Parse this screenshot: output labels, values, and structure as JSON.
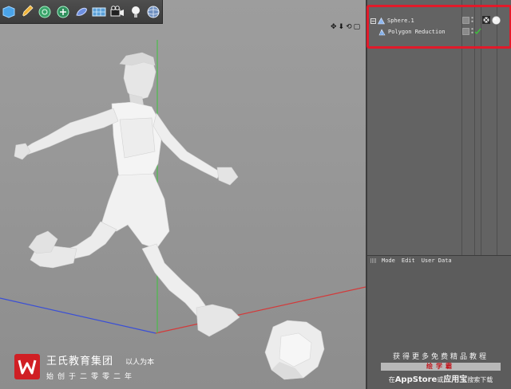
{
  "toolbar": {
    "icons": [
      "cube-add-icon",
      "pen-icon",
      "subdivision-icon",
      "array-icon",
      "deformer-icon",
      "floor-icon",
      "camera-icon",
      "light-icon",
      "sphere-material-icon"
    ]
  },
  "viewport": {
    "nav_icons": [
      "✥",
      "⬇",
      "⟲",
      "▢"
    ]
  },
  "object_manager": {
    "objects": [
      {
        "name": "Sphere.1",
        "icon": "polygon-object-icon"
      },
      {
        "name": "Polygon Reduction",
        "icon": "polygon-reduction-icon"
      }
    ],
    "highlight_color": "#e11a2a"
  },
  "attribute_manager": {
    "menu": [
      "Mode",
      "Edit",
      "User Data"
    ]
  },
  "watermark_left": {
    "brand": "王氏教育集团",
    "slogan": "以人为本",
    "founded": "始创于二零零二年"
  },
  "watermark_right": {
    "line1": "获得更多免费精品教程",
    "app": "绘学霸",
    "line3_pre": "在",
    "line3_store": "AppStore",
    "line3_mid": "或",
    "line3_alt": "应用宝",
    "line3_post": "搜索下载"
  },
  "colors": {
    "axis_x": "#d33a3a",
    "axis_y": "#3cc43c",
    "axis_z": "#3a4fd6",
    "brand_red": "#d01f24"
  }
}
